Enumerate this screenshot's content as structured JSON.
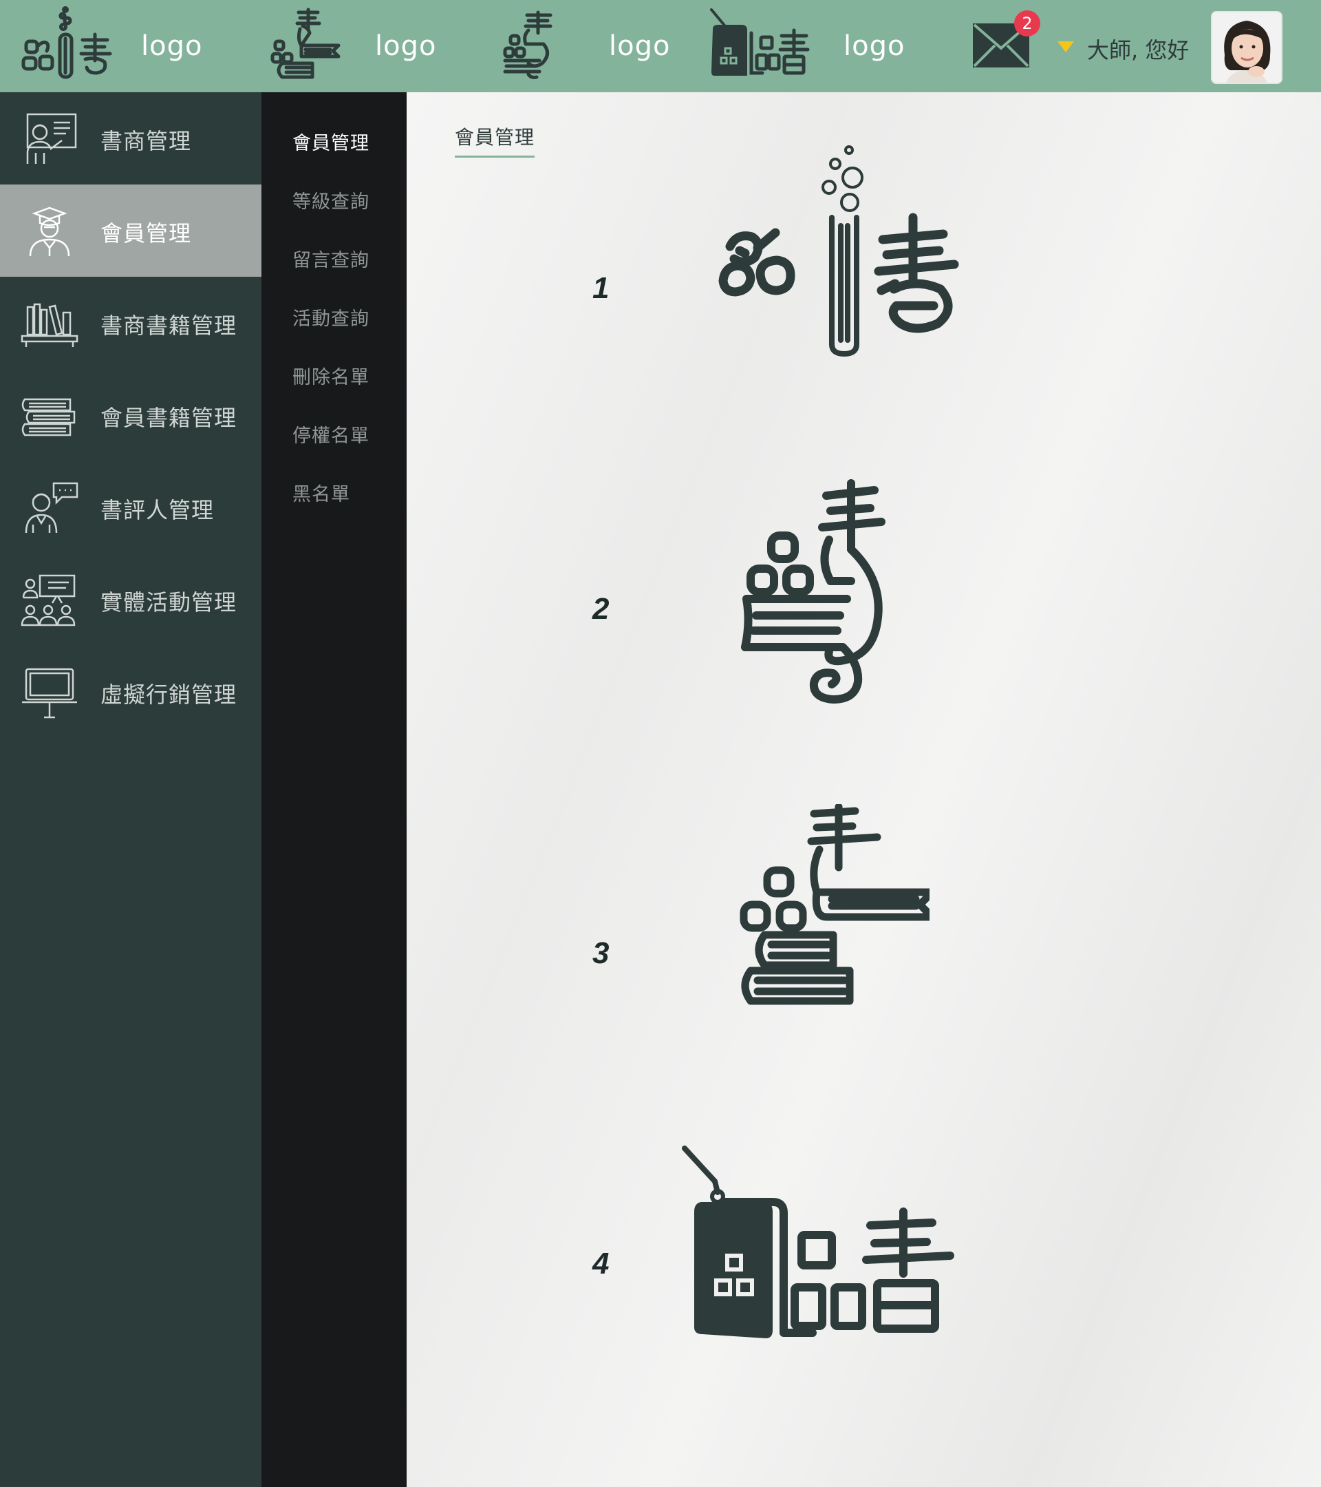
{
  "colors": {
    "topbar": "#84b39c",
    "sidebar": "#2c3c3a",
    "sidebar_active": "#a0a6a3",
    "submenu": "#18191b",
    "badge": "#e8394f",
    "caret": "#f5c518",
    "logo_ink": "#2d3b3a"
  },
  "header": {
    "logos": [
      {
        "icon": "pinshu-testtube-logo-icon",
        "label": "logo"
      },
      {
        "icon": "pinshu-bird-books-logo-icon",
        "label": "logo"
      },
      {
        "icon": "pinshu-bird-logo-icon",
        "label": "logo"
      },
      {
        "icon": "pinshu-teabag-logo-icon",
        "label": "logo"
      }
    ],
    "mail": {
      "icon": "mail-icon",
      "badge_count": "2"
    },
    "user": {
      "caret_icon": "caret-down-icon",
      "greeting": "大師, 您好",
      "avatar_icon": "user-avatar"
    }
  },
  "sidebar": {
    "items": [
      {
        "label": "書商管理",
        "icon": "presenter-board-icon",
        "active": false
      },
      {
        "label": "會員管理",
        "icon": "graduate-icon",
        "active": true
      },
      {
        "label": "書商書籍管理",
        "icon": "bookshelf-icon",
        "active": false
      },
      {
        "label": "會員書籍管理",
        "icon": "book-stack-icon",
        "active": false
      },
      {
        "label": "書評人管理",
        "icon": "reviewer-chat-icon",
        "active": false
      },
      {
        "label": "實體活動管理",
        "icon": "audience-presentation-icon",
        "active": false
      },
      {
        "label": "虛擬行銷管理",
        "icon": "monitor-stand-icon",
        "active": false
      }
    ]
  },
  "submenu": {
    "items": [
      {
        "label": "會員管理",
        "active": true
      },
      {
        "label": "等級查詢",
        "active": false
      },
      {
        "label": "留言查詢",
        "active": false
      },
      {
        "label": "活動查詢",
        "active": false
      },
      {
        "label": "刪除名單",
        "active": false
      },
      {
        "label": "停權名單",
        "active": false
      },
      {
        "label": "黑名單",
        "active": false
      }
    ]
  },
  "main": {
    "breadcrumb": "會員管理",
    "options": [
      {
        "number": "1",
        "icon": "pinshu-testtube-logo-icon"
      },
      {
        "number": "2",
        "icon": "pinshu-bird-logo-icon"
      },
      {
        "number": "3",
        "icon": "pinshu-bird-books-logo-icon"
      },
      {
        "number": "4",
        "icon": "pinshu-teabag-logo-icon"
      }
    ]
  }
}
